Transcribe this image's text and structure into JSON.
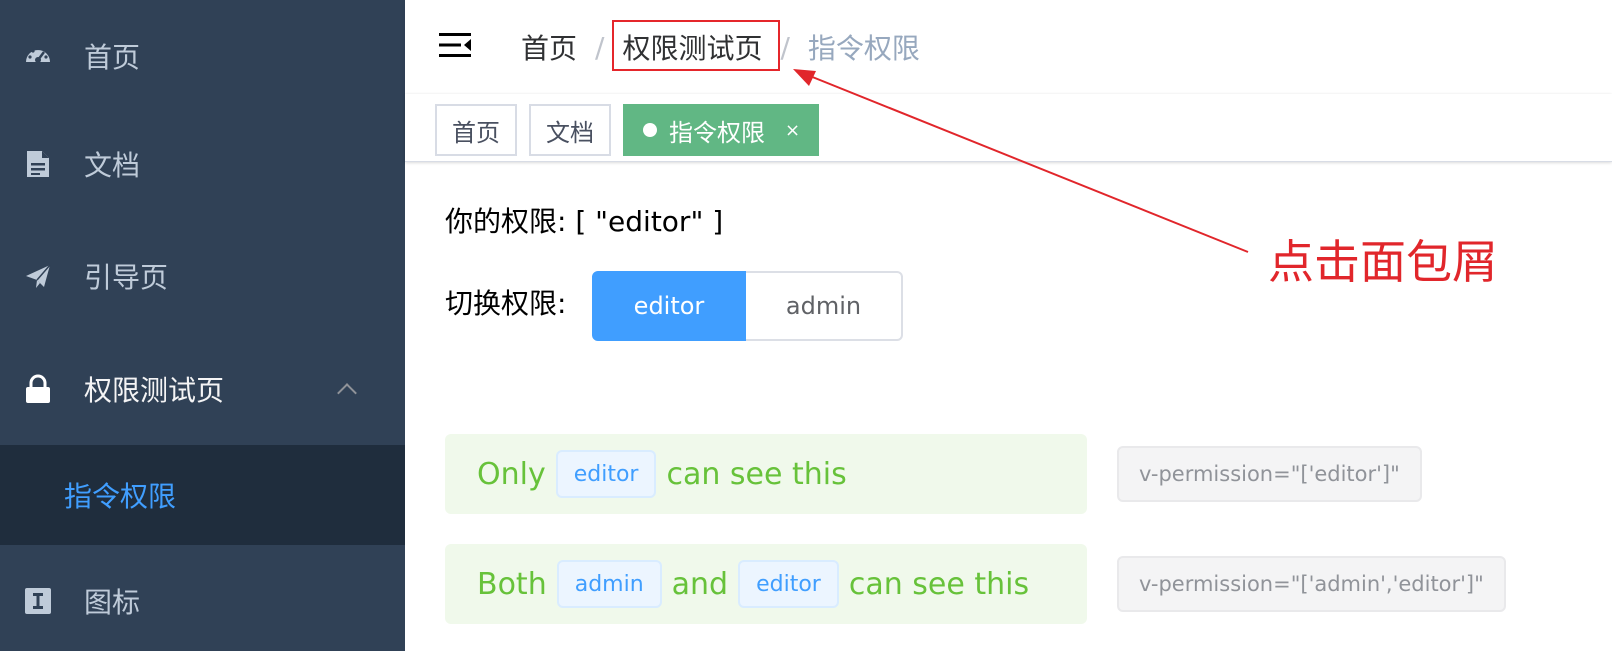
{
  "sidebar": {
    "items": [
      {
        "label": "首页",
        "icon": "dashboard-icon"
      },
      {
        "label": "文档",
        "icon": "document-icon"
      },
      {
        "label": "引导页",
        "icon": "paper-plane-icon"
      },
      {
        "label": "权限测试页",
        "icon": "lock-icon",
        "expanded": true
      },
      {
        "label": "图标",
        "icon": "icon-font-icon"
      }
    ],
    "submenu": [
      {
        "label": "指令权限",
        "active": true
      }
    ],
    "colors": {
      "bg": "#304156",
      "submenu_bg": "#1f2d3d",
      "text": "#bfcbd9",
      "active_text": "#409eff"
    }
  },
  "navbar": {
    "hamburger_icon": "hamburger-icon",
    "breadcrumb": [
      {
        "label": "首页"
      },
      {
        "label": "权限测试页"
      },
      {
        "label": "指令权限"
      }
    ],
    "separator": "/"
  },
  "tags_view": {
    "tags": [
      {
        "label": "首页",
        "active": false
      },
      {
        "label": "文档",
        "active": false
      },
      {
        "label": "指令权限",
        "active": true,
        "close": "×"
      }
    ],
    "active_color": "#61b784"
  },
  "main": {
    "permission_line": "你的权限: [ \"editor\" ]",
    "switch_label": "切换权限:",
    "switch_options": [
      {
        "label": "editor",
        "selected": true
      },
      {
        "label": "admin",
        "selected": false
      }
    ],
    "rows": [
      {
        "parts": [
          "Only",
          "editor",
          "can see this"
        ],
        "code": "v-permission=\"['editor']\""
      },
      {
        "parts": [
          "Both",
          "admin",
          "and",
          "editor",
          "can see this"
        ],
        "code": "v-permission=\"['admin','editor']\""
      }
    ]
  },
  "annotation": {
    "text": "点击面包屑",
    "color": "#e1262b"
  }
}
